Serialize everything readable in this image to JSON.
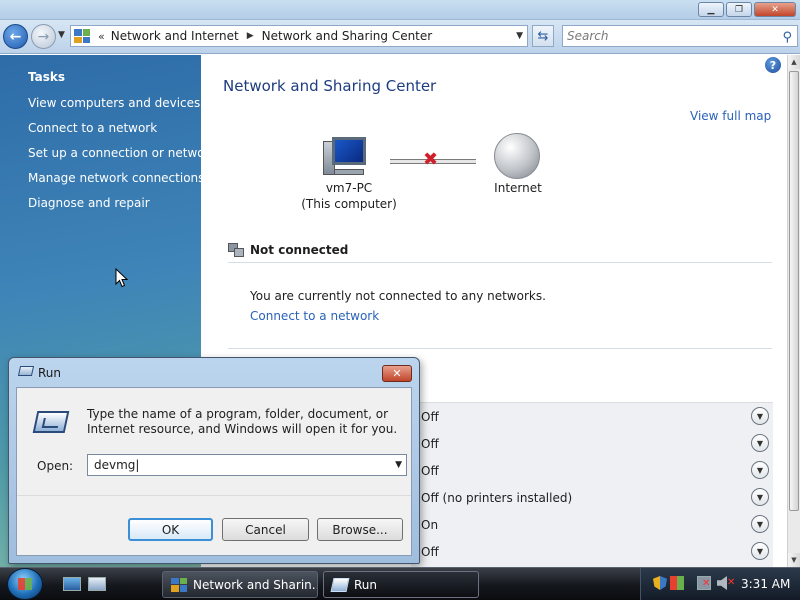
{
  "address": {
    "crumbs": [
      "Network and Internet",
      "Network and Sharing Center"
    ]
  },
  "search": {
    "placeholder": "Search"
  },
  "sidebar": {
    "title": "Tasks",
    "items": [
      "View computers and devices",
      "Connect to a network",
      "Set up a connection or network",
      "Manage network connections",
      "Diagnose and repair"
    ]
  },
  "main": {
    "title": "Network and Sharing Center",
    "view_full_map": "View full map",
    "computer_name": "vm7-PC",
    "computer_sub": "(This computer)",
    "internet_label": "Internet",
    "status_title": "Not connected",
    "status_text": "You are currently not connected to any networks.",
    "connect_link": "Connect to a network",
    "sharing_values": [
      "Off",
      "Off",
      "Off",
      "Off (no printers installed)",
      "On",
      "Off"
    ]
  },
  "run_dialog": {
    "title": "Run",
    "description": "Type the name of a program, folder, document, or Internet resource, and Windows will open it for you.",
    "open_label": "Open:",
    "open_value": "devmg",
    "ok_label": "OK",
    "cancel_label": "Cancel",
    "browse_label": "Browse..."
  },
  "taskbar": {
    "buttons": [
      "Network and Sharin...",
      "Run"
    ],
    "clock": "3:31 AM"
  },
  "icons": {
    "back": "back-arrow-icon",
    "forward": "forward-arrow-icon",
    "help": "help-icon",
    "computer": "computer-icon",
    "internet": "globe-icon",
    "disconnected": "red-x-icon",
    "run": "run-icon"
  },
  "colors": {
    "link": "#2a62b8",
    "title": "#1e3c80",
    "sidebar_top": "#2e6ca8",
    "sidebar_bottom": "#7cb7a8",
    "error_x": "#d0202a"
  }
}
